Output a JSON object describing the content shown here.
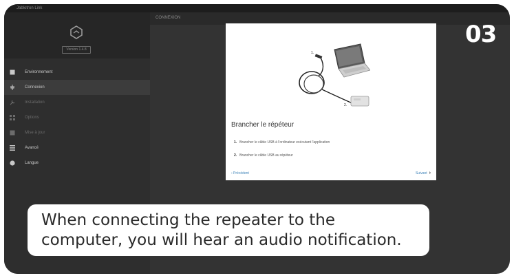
{
  "window": {
    "title": "Jablotron Link"
  },
  "sidebar": {
    "version_label": "Version 1.4.8",
    "items": [
      {
        "label": "Environnement",
        "icon": "square-icon",
        "state": "normal"
      },
      {
        "label": "Connexion",
        "icon": "plug-icon",
        "state": "active"
      },
      {
        "label": "Installation",
        "icon": "wrench-icon",
        "state": "disabled"
      },
      {
        "label": "Options",
        "icon": "grid-icon",
        "state": "disabled"
      },
      {
        "label": "Mise à jour",
        "icon": "download-icon",
        "state": "disabled"
      },
      {
        "label": "Avancé",
        "icon": "menu-icon",
        "state": "normal"
      },
      {
        "label": "Langue",
        "icon": "globe-icon",
        "state": "normal"
      }
    ]
  },
  "breadcrumb": "CONNEXION",
  "panel": {
    "title": "Brancher le répéteur",
    "illustration_labels": {
      "one": "1.",
      "two": "2."
    },
    "steps": [
      {
        "num": "1.",
        "text": "Brancher le câble USB à l'ordinateur exécutant l'application"
      },
      {
        "num": "2.",
        "text": "Brancher le câble USB au répéteur"
      }
    ],
    "prev_label": "‹ Précédent",
    "next_label": "Suivant",
    "next_chevron": "›"
  },
  "step_badge": "03",
  "caption": {
    "line1": "When connecting the repeater to the",
    "line2": "computer, you will hear an audio notification."
  },
  "colors": {
    "frame_bg": "#333333",
    "sidebar_bg": "#2e2e2e",
    "link": "#3c82b8",
    "badge": "#ffffff"
  }
}
